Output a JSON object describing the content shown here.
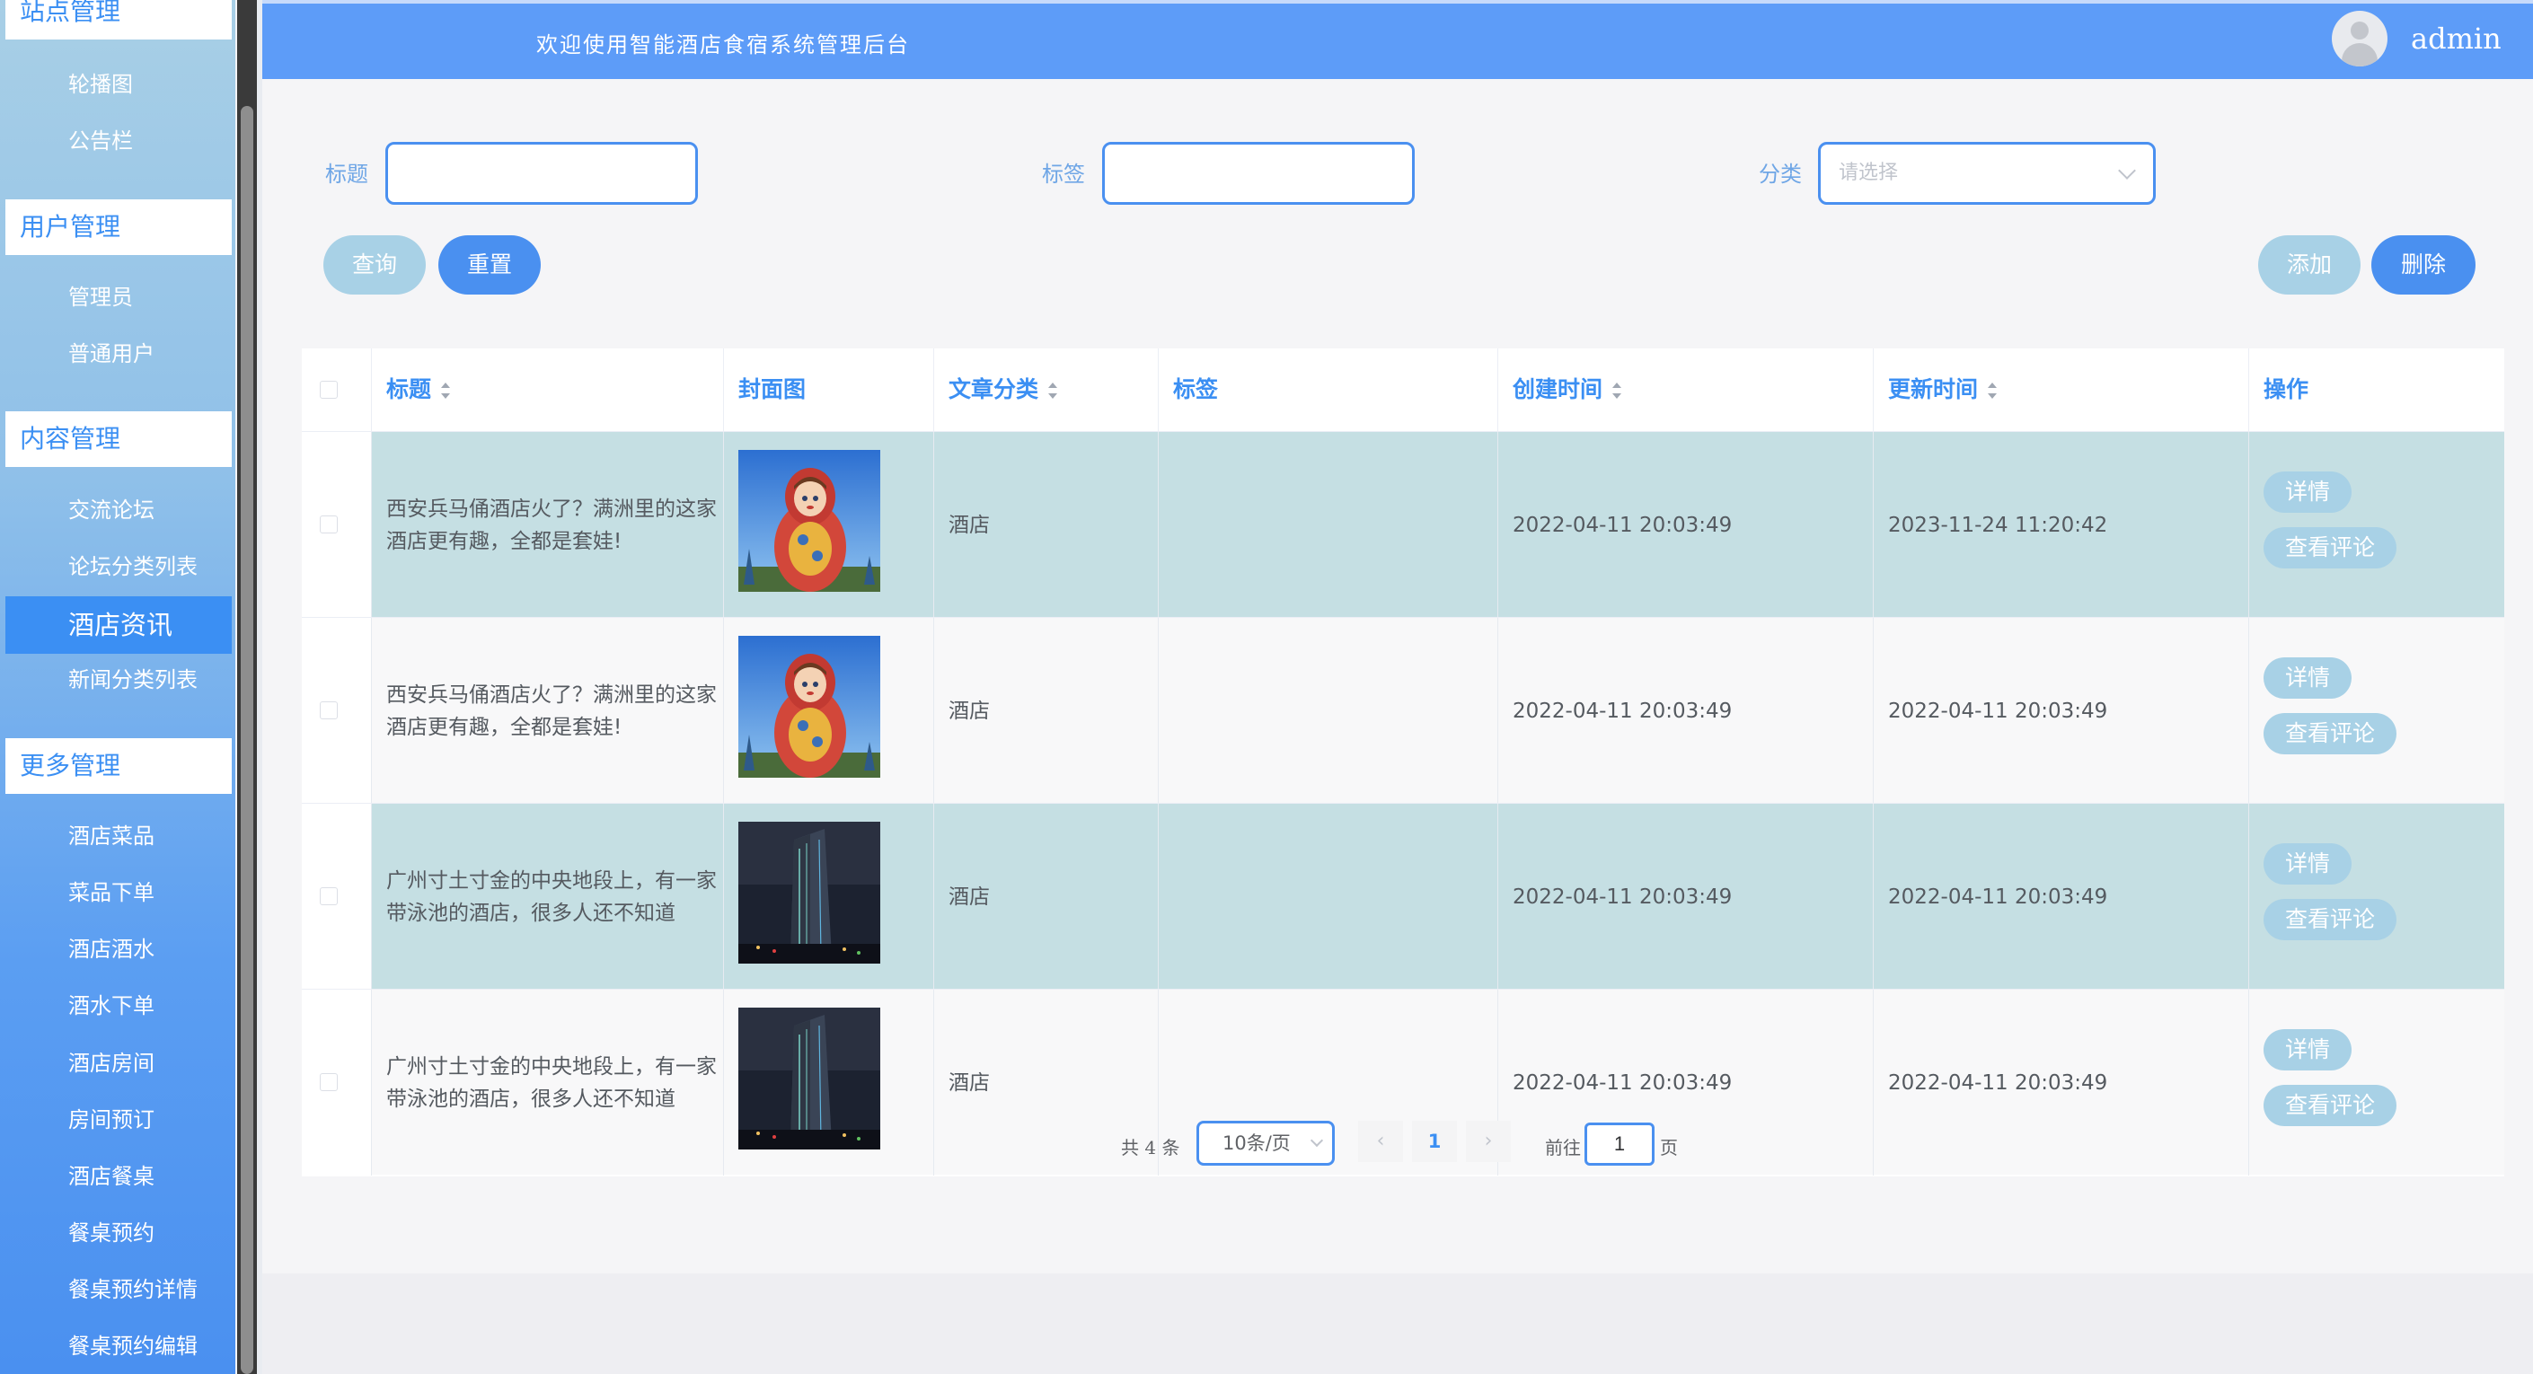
{
  "sidebar": {
    "groups": [
      {
        "title": "站点管理",
        "items": [
          "轮播图",
          "公告栏"
        ]
      },
      {
        "title": "用户管理",
        "items": [
          "管理员",
          "普通用户"
        ]
      },
      {
        "title": "内容管理",
        "items": [
          "交流论坛",
          "论坛分类列表",
          "酒店资讯",
          "新闻分类列表"
        ]
      },
      {
        "title": "更多管理",
        "items": [
          "酒店菜品",
          "菜品下单",
          "酒店酒水",
          "酒水下单",
          "酒店房间",
          "房间预订",
          "酒店餐桌",
          "餐桌预约",
          "餐桌预约详情",
          "餐桌预约编辑"
        ]
      }
    ],
    "active_item": "酒店资讯"
  },
  "header": {
    "title": "欢迎使用智能酒店食宿系统管理后台",
    "user": "admin"
  },
  "search": {
    "title_label": "标题",
    "tag_label": "标签",
    "category_label": "分类",
    "category_placeholder": "请选择",
    "query_btn": "查询",
    "reset_btn": "重置",
    "add_btn": "添加",
    "delete_btn": "删除"
  },
  "table": {
    "headers": {
      "title": "标题",
      "cover": "封面图",
      "category": "文章分类",
      "tag": "标签",
      "created": "创建时间",
      "updated": "更新时间",
      "ops": "操作"
    },
    "rows": [
      {
        "title": "西安兵马俑酒店火了？满洲里的这家酒店更有趣，全都是套娃!",
        "title_l1": "西安兵马俑酒店火了？满洲里的这家",
        "title_l2": "酒店更有趣，全都是套娃!",
        "category": "酒店",
        "tag": "",
        "created": "2022-04-11 20:03:49",
        "updated": "2023-11-24 11:20:42",
        "cover": "matryoshka"
      },
      {
        "title": "西安兵马俑酒店火了？满洲里的这家酒店更有趣，全都是套娃!",
        "title_l1": "西安兵马俑酒店火了？满洲里的这家",
        "title_l2": "酒店更有趣，全都是套娃!",
        "category": "酒店",
        "tag": "",
        "created": "2022-04-11 20:03:49",
        "updated": "2022-04-11 20:03:49",
        "cover": "matryoshka"
      },
      {
        "title": "广州寸土寸金的中央地段上，有一家带泳池的酒店，很多人还不知道",
        "title_l1": "广州寸土寸金的中央地段上，有一家",
        "title_l2": "带泳池的酒店，很多人还不知道",
        "category": "酒店",
        "tag": "",
        "created": "2022-04-11 20:03:49",
        "updated": "2022-04-11 20:03:49",
        "cover": "skyscraper"
      },
      {
        "title": "广州寸土寸金的中央地段上，有一家带泳池的酒店，很多人还不知道",
        "title_l1": "广州寸土寸金的中央地段上，有一家",
        "title_l2": "带泳池的酒店，很多人还不知道",
        "category": "酒店",
        "tag": "",
        "created": "2022-04-11 20:03:49",
        "updated": "2022-04-11 20:03:49",
        "cover": "skyscraper"
      }
    ],
    "detail_btn": "详情",
    "comments_btn": "查看评论"
  },
  "pagination": {
    "total_text": "共 4 条",
    "page_size": "10条/页",
    "prev_icon": "‹",
    "next_icon": "›",
    "current_page": "1",
    "goto_label": "前往",
    "goto_value": "1",
    "page_suffix": "页"
  },
  "colors": {
    "accent": "#4a90f0",
    "header_bg": "#5d9cf8",
    "row_shade": "#c5dfe3",
    "light_button": "#a8d1e6"
  }
}
